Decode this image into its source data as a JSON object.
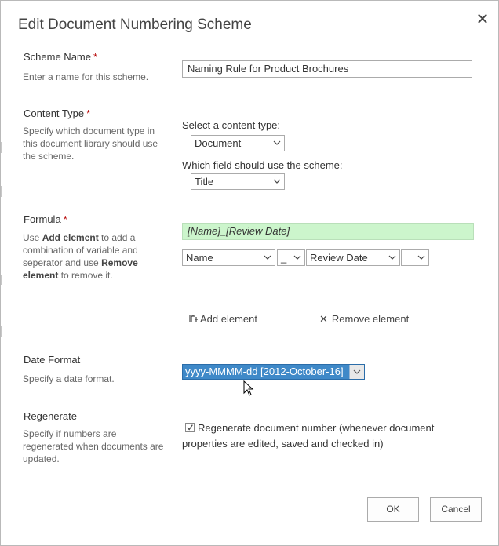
{
  "dialog": {
    "title": "Edit Document Numbering Scheme"
  },
  "scheme_name": {
    "label": "Scheme Name",
    "required_mark": "*",
    "description": "Enter a name for this scheme.",
    "value": "Naming Rule for Product Brochures"
  },
  "content_type": {
    "label": "Content Type",
    "required_mark": "*",
    "description": "Specify which document type in this document library should use the scheme.",
    "select_label": "Select a content type:",
    "select_value": "Document",
    "field_label": "Which field should use the scheme:",
    "field_value": "Title"
  },
  "formula": {
    "label": "Formula",
    "required_mark": "*",
    "desc_1": "Use ",
    "desc_bold_1": "Add element",
    "desc_2": " to add a combination of variable and seperator and use ",
    "desc_bold_2": "Remove element",
    "desc_3": " to remove it.",
    "value": "[Name]_[Review Date]",
    "element_1": "Name",
    "separator_1": "_",
    "element_2": "Review Date",
    "separator_2": "",
    "add_label": "Add element",
    "remove_label": "Remove element"
  },
  "date_format": {
    "label": "Date Format",
    "description": "Specify a date format.",
    "value": "yyyy-MMMM-dd [2012-October-16]"
  },
  "regenerate": {
    "label": "Regenerate",
    "description": "Specify if numbers are regenerated when documents are updated.",
    "checkbox_label": "Regenerate document number (whenever document properties are edited, saved and checked in)",
    "checked": true
  },
  "buttons": {
    "ok": "OK",
    "cancel": "Cancel"
  },
  "colors": {
    "formula_bg": "#ccf5cc",
    "selected_bg": "#3f89c8",
    "required": "#b50000"
  }
}
